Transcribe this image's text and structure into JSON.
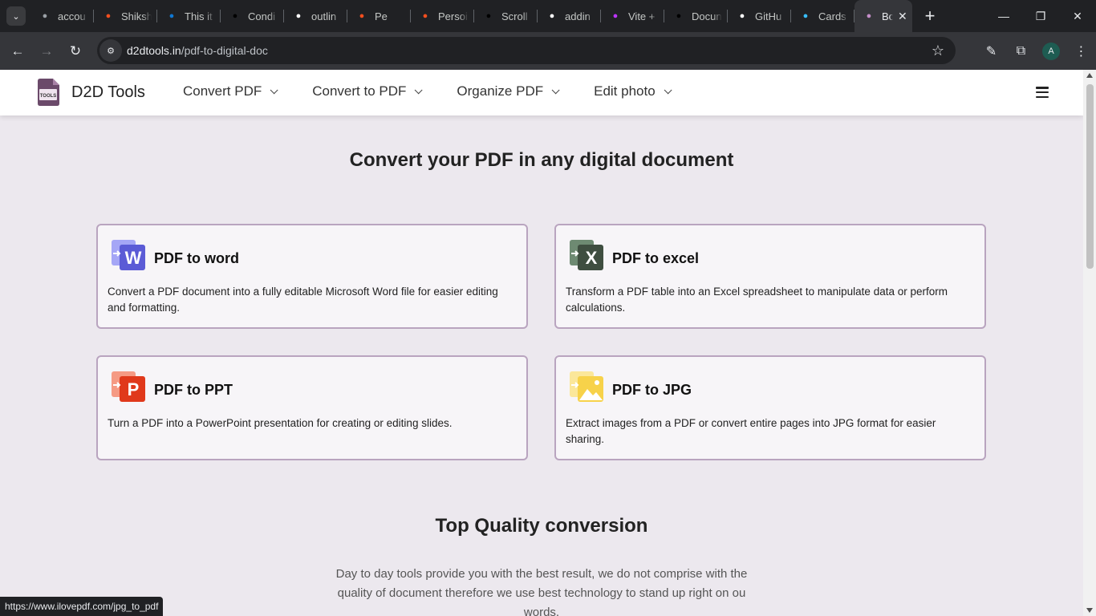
{
  "browser": {
    "tabs": [
      {
        "title": "accou",
        "icon": "globe-icon",
        "color": "#9aa0a6"
      },
      {
        "title": "Shiksh",
        "icon": "figma-icon",
        "color": "#f24e1e"
      },
      {
        "title": "This it",
        "icon": "onedrive-icon",
        "color": "#0f78d4"
      },
      {
        "title": "Condi",
        "icon": "dev-icon",
        "color": "#000000"
      },
      {
        "title": "outlin",
        "icon": "github-icon",
        "color": "#ffffff"
      },
      {
        "title": "Pe",
        "icon": "figma-icon",
        "color": "#f24e1e"
      },
      {
        "title": "Persoi",
        "icon": "figma-icon",
        "color": "#f24e1e"
      },
      {
        "title": "Scroll",
        "icon": "framer-icon",
        "color": "#000000"
      },
      {
        "title": "addin",
        "icon": "google-icon",
        "color": "#ffffff"
      },
      {
        "title": "Vite +",
        "icon": "vite-icon",
        "color": "#bd34fe"
      },
      {
        "title": "Docun",
        "icon": "framer-icon",
        "color": "#000000"
      },
      {
        "title": "GitHu",
        "icon": "github-icon",
        "color": "#ffffff"
      },
      {
        "title": "Cards",
        "icon": "tailwind-icon",
        "color": "#38bdf8"
      },
      {
        "title": "Bo",
        "icon": "d2d-icon",
        "color": "#c58ec9",
        "active": true
      }
    ],
    "url_host": "d2dtools.in",
    "url_path": "/pdf-to-digital-doc",
    "avatar_letter": "A",
    "status_url": "https://www.ilovepdf.com/jpg_to_pdf"
  },
  "site": {
    "brand": "D2D Tools",
    "logo_text": "TOOLS",
    "menu": [
      {
        "label": "Convert PDF"
      },
      {
        "label": "Convert to PDF"
      },
      {
        "label": "Organize PDF"
      },
      {
        "label": "Edit photo"
      }
    ],
    "page_title": "Convert your PDF in any digital document",
    "cards": [
      {
        "title": "PDF to word",
        "desc": "Convert a PDF document into a fully editable Microsoft Word file for easier editing and formatting.",
        "icon": "word-icon",
        "letter": "W",
        "color": "#5b5bd6",
        "color_back": "#a5a6f6"
      },
      {
        "title": "PDF to excel",
        "desc": "Transform a PDF table into an Excel spreadsheet to manipulate data or perform calculations.",
        "icon": "excel-icon",
        "letter": "X",
        "color": "#3f4e40",
        "color_back": "#6e8a72"
      },
      {
        "title": "PDF to PPT",
        "desc": "Turn a PDF into a PowerPoint presentation for creating or editing slides.",
        "icon": "ppt-icon",
        "letter": "P",
        "color": "#e0391b",
        "color_back": "#f59a84"
      },
      {
        "title": "PDF to JPG",
        "desc": "Extract images from a PDF or convert entire pages into JPG format for easier sharing.",
        "icon": "jpg-icon",
        "letter": "",
        "color": "#f7d24a",
        "color_back": "#fbe79a"
      }
    ],
    "section_title": "Top Quality conversion",
    "section_body": "Day to day tools provide you with the best result, we do not comprise with the quality of document therefore we use best technology to stand up right on ou words."
  }
}
